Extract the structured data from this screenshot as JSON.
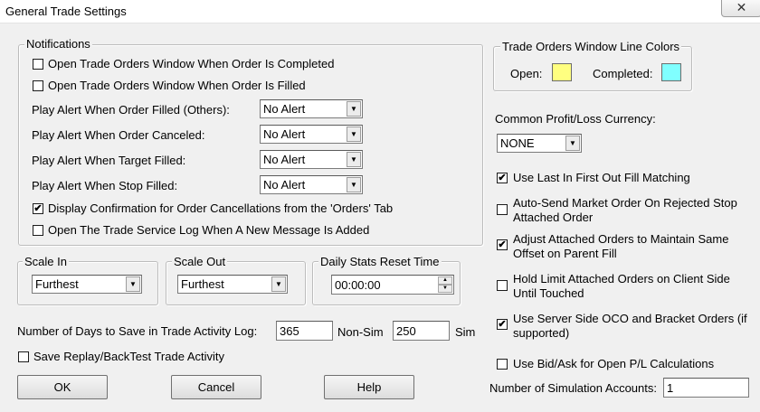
{
  "window": {
    "title": "General Trade Settings",
    "close_icon": "✕"
  },
  "notifications": {
    "label": "Notifications",
    "open_on_completed": {
      "checked": false,
      "label": "Open Trade Orders Window When Order Is Completed"
    },
    "open_on_filled": {
      "checked": false,
      "label": "Open Trade Orders Window When Order Is Filled"
    },
    "alerts": [
      {
        "label": "Play Alert When Order Filled (Others):",
        "value": "No Alert"
      },
      {
        "label": "Play Alert When Order Canceled:",
        "value": "No Alert"
      },
      {
        "label": "Play Alert When Target Filled:",
        "value": "No Alert"
      },
      {
        "label": "Play Alert When Stop Filled:",
        "value": "No Alert"
      }
    ],
    "display_confirmation": {
      "checked": true,
      "label": "Display Confirmation for Order Cancellations from the 'Orders' Tab"
    },
    "open_service_log": {
      "checked": false,
      "label": "Open The Trade Service Log When A New Message Is Added"
    }
  },
  "scale_in": {
    "label": "Scale In",
    "value": "Furthest"
  },
  "scale_out": {
    "label": "Scale Out",
    "value": "Furthest"
  },
  "daily_stats": {
    "label": "Daily Stats Reset Time",
    "value": "00:00:00"
  },
  "activity_log": {
    "label": "Number of Days to Save in Trade Activity Log:",
    "non_sim_value": "365",
    "non_sim_label": "Non-Sim",
    "sim_value": "250",
    "sim_label": "Sim"
  },
  "save_replay": {
    "checked": false,
    "label": "Save Replay/BackTest Trade Activity"
  },
  "buttons": {
    "ok": "OK",
    "cancel": "Cancel",
    "help": "Help"
  },
  "line_colors": {
    "label": "Trade Orders Window Line Colors",
    "open_label": "Open:",
    "open_color": "#ffff80",
    "completed_label": "Completed:",
    "completed_color": "#80ffff"
  },
  "currency": {
    "label": "Common Profit/Loss Currency:",
    "value": "NONE"
  },
  "options": {
    "lifo": {
      "checked": true,
      "label": "Use Last In First Out Fill Matching"
    },
    "auto_send": {
      "checked": false,
      "line1": "Auto-Send Market Order On Rejected Stop",
      "line2": "Attached Order"
    },
    "adjust_attached": {
      "checked": true,
      "line1": "Adjust Attached Orders to Maintain Same",
      "line2": "Offset on Parent Fill"
    },
    "hold_limit": {
      "checked": false,
      "line1": "Hold Limit Attached Orders on Client Side",
      "line2": "Until Touched"
    },
    "server_oco": {
      "checked": true,
      "line1": "Use Server Side OCO and Bracket Orders (if",
      "line2": "supported)"
    },
    "bid_ask": {
      "checked": false,
      "label": "Use Bid/Ask for Open P/L Calculations"
    }
  },
  "sim_accounts": {
    "label": "Number of Simulation Accounts:",
    "value": "1"
  },
  "icons": {
    "check_mark": "✔",
    "dropdown_arrow": "▼",
    "spin_up": "▲",
    "spin_down": "▼"
  }
}
